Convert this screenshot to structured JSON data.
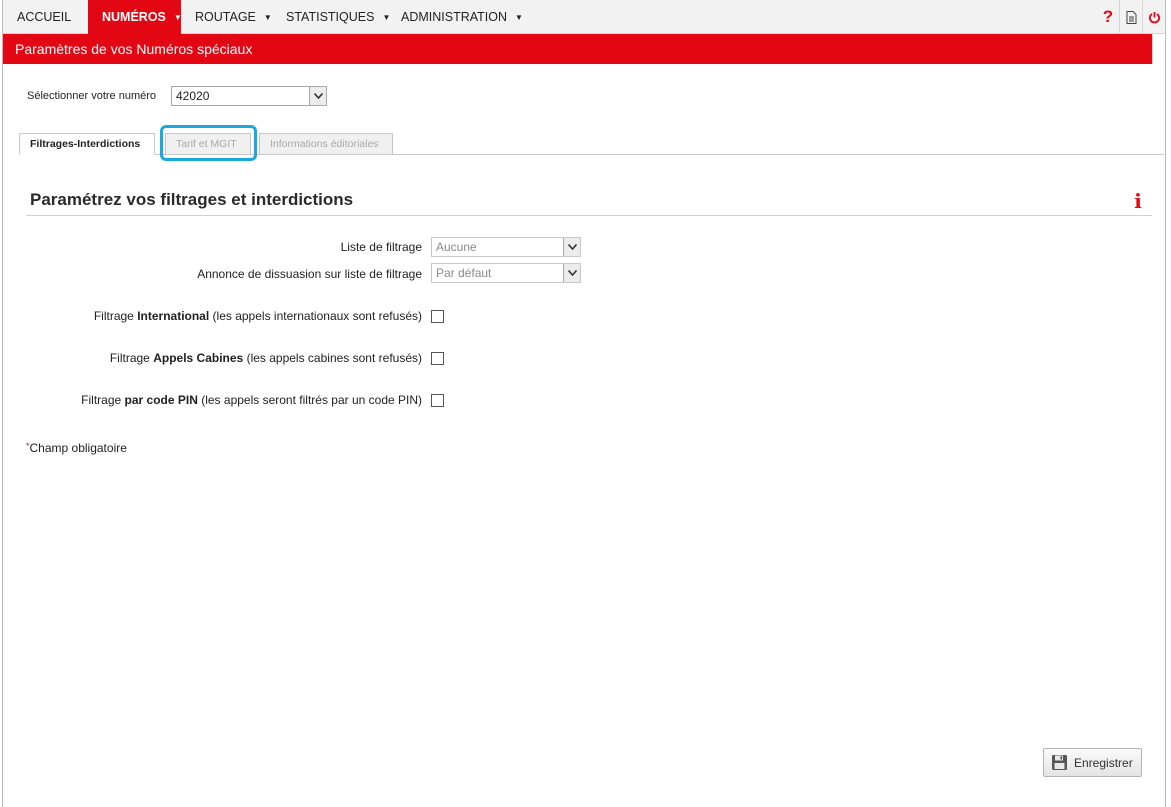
{
  "nav": {
    "items": [
      {
        "label": "ACCUEIL",
        "active": false,
        "has_caret": false
      },
      {
        "label": "NUMÉROS",
        "active": true,
        "has_caret": true
      },
      {
        "label": "ROUTAGE",
        "active": false,
        "has_caret": true
      },
      {
        "label": "STATISTIQUES",
        "active": false,
        "has_caret": true
      },
      {
        "label": "ADMINISTRATION",
        "active": false,
        "has_caret": true
      }
    ],
    "caret": "▼",
    "icons": [
      "help-icon",
      "document-icon",
      "power-icon"
    ],
    "help_glyph": "?"
  },
  "page_title": "Paramètres de vos Numéros spéciaux",
  "number_select": {
    "label": "Sélectionner votre numéro",
    "value": "42020"
  },
  "tabs": [
    {
      "label": "Filtrages-Interdictions",
      "active": true
    },
    {
      "label": "Tarif et MGIT",
      "active": false,
      "highlighted": true
    },
    {
      "label": "Informations éditoriales",
      "active": false
    }
  ],
  "section": {
    "title": "Paramétrez vos filtrages et interdictions",
    "info_glyph": "i"
  },
  "form": {
    "filter_list": {
      "label": "Liste de filtrage",
      "value": "Aucune"
    },
    "dissuasion": {
      "label": "Annonce de dissuasion sur liste de filtrage",
      "value": "Par défaut"
    },
    "international": {
      "prefix": "Filtrage ",
      "bold": "International",
      "suffix": " (les appels internationaux sont refusés)",
      "checked": false
    },
    "cabins": {
      "prefix": "Filtrage ",
      "bold": "Appels Cabines",
      "suffix": " (les appels cabines sont refusés)",
      "checked": false
    },
    "pin": {
      "prefix": "Filtrage ",
      "bold": "par code PIN",
      "suffix": " (les appels seront filtrés par un code PIN)",
      "checked": false
    }
  },
  "required_note": {
    "star": "*",
    "text": "Champ obligatoire"
  },
  "save_button": {
    "label": "Enregistrer",
    "icon": "floppy-disk-icon"
  },
  "colors": {
    "brand_red": "#e30613",
    "highlight_blue": "#1ba8e0"
  }
}
